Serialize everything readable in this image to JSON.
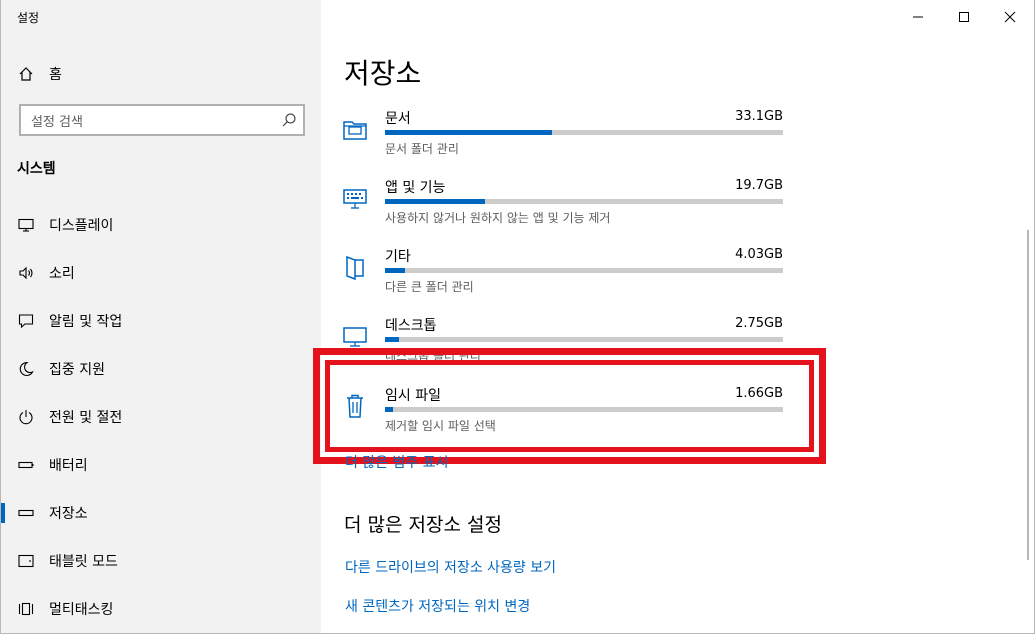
{
  "window": {
    "title": "설정",
    "controls": [
      "minimize",
      "maximize",
      "close"
    ]
  },
  "sidebar": {
    "home_label": "홈",
    "search_placeholder": "설정 검색",
    "section_label": "시스템",
    "items": [
      {
        "label": "디스플레이",
        "icon": "monitor-icon"
      },
      {
        "label": "소리",
        "icon": "speaker-icon"
      },
      {
        "label": "알림 및 작업",
        "icon": "notification-icon"
      },
      {
        "label": "집중 지원",
        "icon": "moon-icon"
      },
      {
        "label": "전원 및 절전",
        "icon": "power-icon"
      },
      {
        "label": "배터리",
        "icon": "battery-icon"
      },
      {
        "label": "저장소",
        "icon": "storage-icon",
        "active": true
      },
      {
        "label": "태블릿 모드",
        "icon": "tablet-icon"
      },
      {
        "label": "멀티태스킹",
        "icon": "multitasking-icon"
      }
    ]
  },
  "main": {
    "title": "저장소",
    "storage_items": [
      {
        "name": "문서",
        "size": "33.1GB",
        "desc": "문서 폴더 관리",
        "fill": 0.42,
        "icon": "documents-icon"
      },
      {
        "name": "앱 및 기능",
        "size": "19.7GB",
        "desc": "사용하지 않거나 원하지 않는 앱 및 기능 제거",
        "fill": 0.25,
        "icon": "keyboard-icon"
      },
      {
        "name": "기타",
        "size": "4.03GB",
        "desc": "다른 큰 폴더 관리",
        "fill": 0.05,
        "icon": "folder-icon"
      },
      {
        "name": "데스크톱",
        "size": "2.75GB",
        "desc": "데스크톱 폴더 관리",
        "fill": 0.035,
        "icon": "desktop-icon"
      },
      {
        "name": "임시 파일",
        "size": "1.66GB",
        "desc": "제거할 임시 파일 선택",
        "fill": 0.02,
        "icon": "trash-icon"
      }
    ],
    "more_categories_link": "더 많은 범주 표시",
    "more_settings_title": "더 많은 저장소 설정",
    "links": [
      "다른 드라이브의 저장소 사용량 보기",
      "새 콘텐츠가 저장되는 위치 변경"
    ]
  },
  "colors": {
    "accent": "#0067c0",
    "highlight": "#e3121b",
    "sidebar_bg": "#f2f2f2",
    "bar_bg": "#cccccc"
  }
}
